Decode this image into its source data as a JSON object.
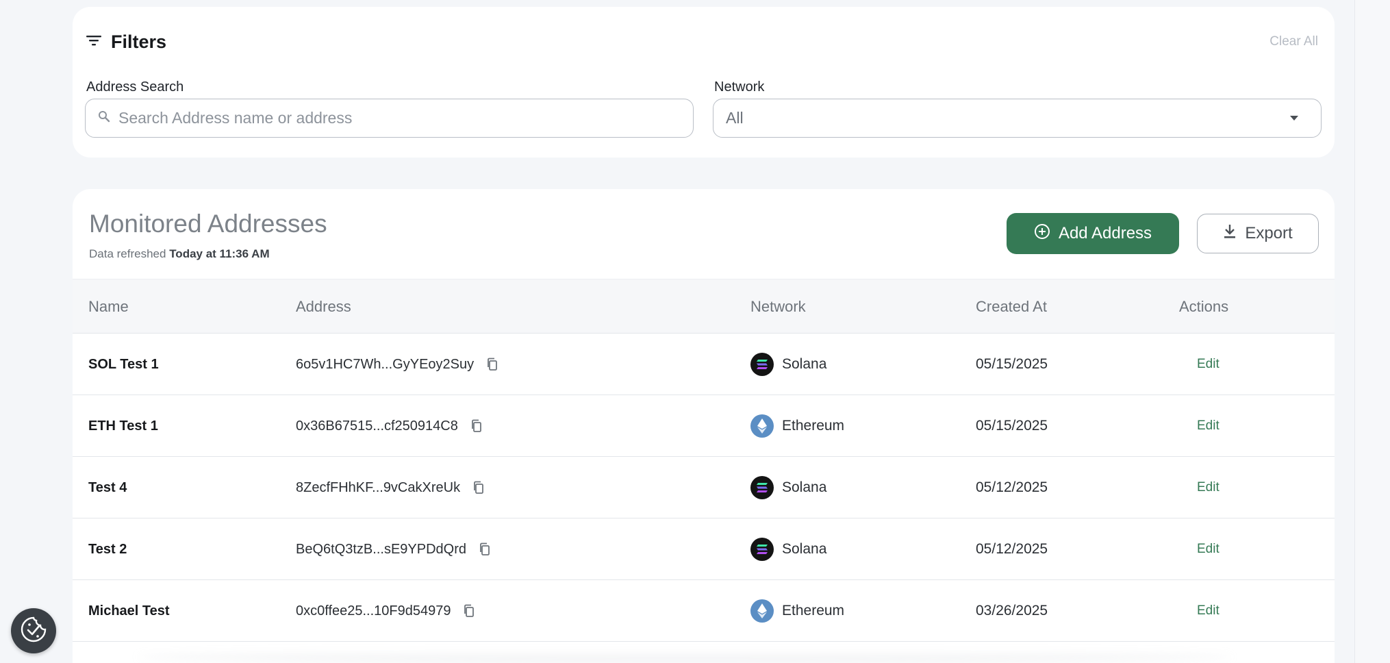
{
  "filters": {
    "title": "Filters",
    "clear_all": "Clear All",
    "address_label": "Address Search",
    "address_placeholder": "Search Address name or address",
    "network_label": "Network",
    "network_value": "All"
  },
  "monitored": {
    "title": "Monitored Addresses",
    "refresh_prefix": "Data refreshed",
    "refresh_time": "Today at 11:36 AM",
    "add_label": "Add Address",
    "export_label": "Export"
  },
  "table": {
    "headers": [
      "Name",
      "Address",
      "Network",
      "Created At",
      "Actions"
    ],
    "rows": [
      {
        "name": "SOL Test 1",
        "address": "6o5v1HC7Wh...GyYEoy2Suy",
        "network": "Solana",
        "network_icon": "solana-logo-icon",
        "created": "05/15/2025",
        "action": "Edit"
      },
      {
        "name": "ETH Test 1",
        "address": "0x36B67515...cf250914C8",
        "network": "Ethereum",
        "network_icon": "ethereum-logo-icon",
        "created": "05/15/2025",
        "action": "Edit"
      },
      {
        "name": "Test 4",
        "address": "8ZecfFHhKF...9vCakXreUk",
        "network": "Solana",
        "network_icon": "solana-logo-icon",
        "created": "05/12/2025",
        "action": "Edit"
      },
      {
        "name": "Test 2",
        "address": "BeQ6tQ3tzB...sE9YPDdQrd",
        "network": "Solana",
        "network_icon": "solana-logo-icon",
        "created": "05/12/2025",
        "action": "Edit"
      },
      {
        "name": "Michael Test",
        "address": "0xc0ffee25...10F9d54979",
        "network": "Ethereum",
        "network_icon": "ethereum-logo-icon",
        "created": "03/26/2025",
        "action": "Edit"
      }
    ]
  },
  "colors": {
    "accent": "#357a55",
    "background": "#f4f6f9"
  },
  "icons": {
    "filter": "filter-icon",
    "search": "search-icon",
    "dropdown": "chevron-down-icon",
    "add": "plus-circle-icon",
    "export": "download-icon",
    "copy": "copy-icon",
    "cookie": "cookie-consent-icon"
  }
}
